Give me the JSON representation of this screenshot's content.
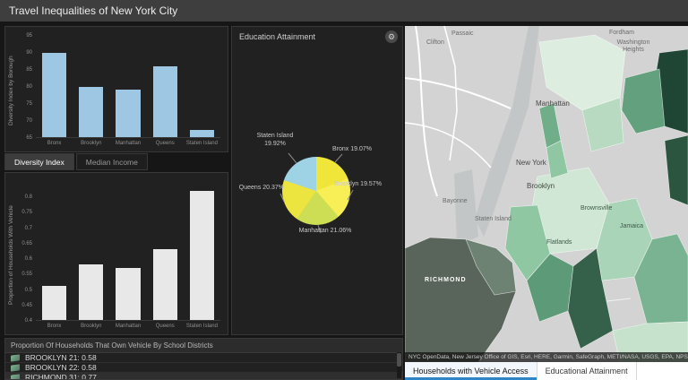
{
  "header": {
    "title": "Travel Inequalities of New York City"
  },
  "icons": {
    "widget_menu": "⚙"
  },
  "chart_tabs": [
    {
      "label": "Diversity Index",
      "active": true
    },
    {
      "label": "Median Income",
      "active": false
    }
  ],
  "charts": {
    "diversity": {
      "type": "bar",
      "categories": [
        "Bronx",
        "Brooklyn",
        "Manhattan",
        "Queens",
        "Staten Island"
      ],
      "values": [
        90,
        80,
        79,
        86,
        67
      ],
      "ylabel": "Diversity Index by Borough",
      "ylim": [
        65,
        95
      ],
      "yticks": [
        65,
        70,
        75,
        80,
        85,
        90,
        95
      ],
      "bar_color": "#9dc7e3"
    },
    "vehicle": {
      "type": "bar",
      "categories": [
        "Bronx",
        "Brooklyn",
        "Manhattan",
        "Queens",
        "Staten Island"
      ],
      "values": [
        0.51,
        0.58,
        0.57,
        0.63,
        0.82
      ],
      "ylabel": "Proportion of Households With Vehicle",
      "ylim": [
        0.4,
        0.85
      ],
      "yticks": [
        0.4,
        0.45,
        0.5,
        0.55,
        0.6,
        0.65,
        0.7,
        0.75,
        0.8
      ],
      "bar_color": "#e8e8e8"
    },
    "education_pie": {
      "type": "pie",
      "title": "Education Attainment",
      "slices": [
        {
          "label": "Bronx 19.07%",
          "value": 19.07,
          "color": "#f0e63a"
        },
        {
          "label": "Brooklyn 19.57%",
          "value": 19.57,
          "color": "#f7ef55"
        },
        {
          "label": "Manhattan 21.06%",
          "value": 21.06,
          "color": "#cdde55"
        },
        {
          "label": "Queens 20.37%",
          "value": 20.37,
          "color": "#ece43f"
        },
        {
          "label": "Staten Island 19.92%",
          "value": 19.92,
          "color": "#9dd3e4"
        }
      ]
    }
  },
  "district_list": {
    "title": "Proportion Of Households That Own Vehicle By School Districts",
    "items": [
      {
        "label": "BROOKLYN 21: 0.58"
      },
      {
        "label": "BROOKLYN 22: 0.58"
      },
      {
        "label": "RICHMOND 31: 0.77"
      }
    ]
  },
  "map": {
    "labels": [
      {
        "text": "Passaic"
      },
      {
        "text": "Clifton"
      },
      {
        "text": "Fordham"
      },
      {
        "text": "Washington Heights"
      },
      {
        "text": "Manhattan"
      },
      {
        "text": "New York"
      },
      {
        "text": "Brooklyn"
      },
      {
        "text": "Bayonne"
      },
      {
        "text": "Staten Island"
      },
      {
        "text": "RICHMOND"
      },
      {
        "text": "Brownsville"
      },
      {
        "text": "Flatlands"
      },
      {
        "text": "Jamaica"
      }
    ],
    "attribution": "NYC OpenData, New Jersey Office of GIS, Esri, HERE, Garmin, SafeGraph, METI/NASA, USGS, EPA, NPS, USDA",
    "tabs": [
      {
        "label": "Households with Vehicle Access",
        "active": true
      },
      {
        "label": "Educational Attainment",
        "active": false
      }
    ]
  }
}
